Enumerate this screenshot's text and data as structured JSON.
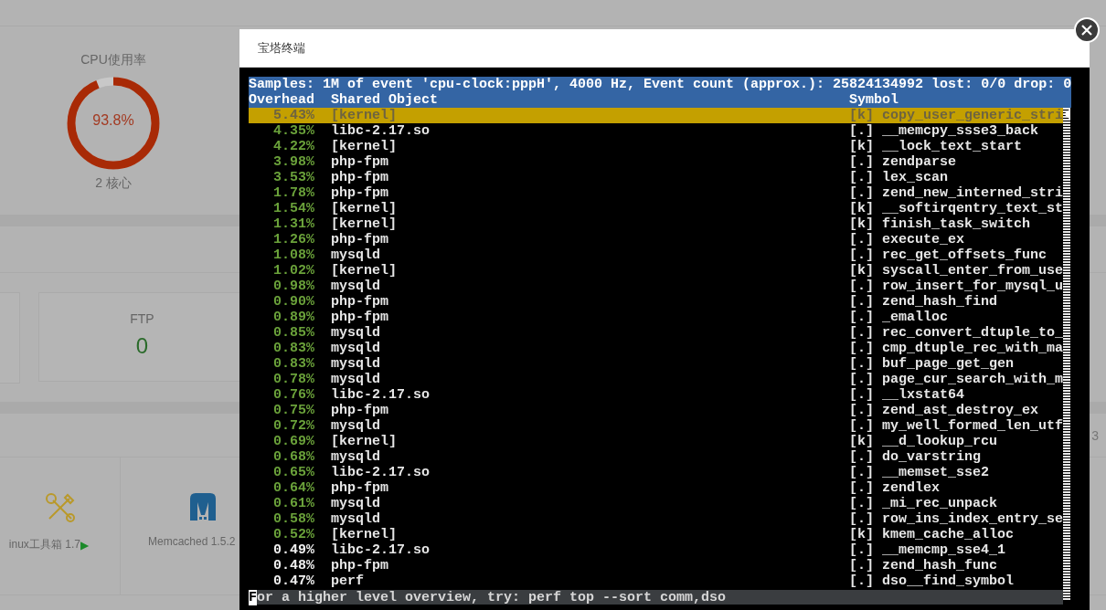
{
  "dashboard": {
    "cpu": {
      "title": "CPU使用率",
      "value": "93.8%",
      "level": 0.938,
      "cores": "2 核心"
    },
    "stat_cards": [
      {
        "label": "FTP",
        "value": "0"
      }
    ],
    "section_fragment": "3",
    "software": [
      {
        "kind": "toolbox",
        "label": "inux工具箱 1.7",
        "marker": "▶"
      },
      {
        "kind": "memcached",
        "label": "Memcached 1.5.2"
      }
    ]
  },
  "modal": {
    "title": "宝塔终端",
    "terminal": {
      "summary": "Samples: 1M of event 'cpu-clock:pppH', 4000 Hz, Event count (approx.): 25824134992 lost: 0/0 drop: 0",
      "columns": [
        "Overhead",
        "Shared Object",
        "Symbol"
      ],
      "rows": [
        {
          "overhead": "5.43%",
          "object": "[kernel]",
          "symbol": "[k] copy_user_generic_stri",
          "hot": true,
          "selected": true
        },
        {
          "overhead": "4.35%",
          "object": "libc-2.17.so",
          "symbol": "[.] __memcpy_ssse3_back",
          "hot": true,
          "selected": false
        },
        {
          "overhead": "4.22%",
          "object": "[kernel]",
          "symbol": "[k] __lock_text_start",
          "hot": true,
          "selected": false
        },
        {
          "overhead": "3.98%",
          "object": "php-fpm",
          "symbol": "[.] zendparse",
          "hot": true,
          "selected": false
        },
        {
          "overhead": "3.53%",
          "object": "php-fpm",
          "symbol": "[.] lex_scan",
          "hot": true,
          "selected": false
        },
        {
          "overhead": "1.78%",
          "object": "php-fpm",
          "symbol": "[.] zend_new_interned_stri",
          "hot": true,
          "selected": false
        },
        {
          "overhead": "1.54%",
          "object": "[kernel]",
          "symbol": "[k] __softirqentry_text_st",
          "hot": true,
          "selected": false
        },
        {
          "overhead": "1.31%",
          "object": "[kernel]",
          "symbol": "[k] finish_task_switch",
          "hot": true,
          "selected": false
        },
        {
          "overhead": "1.26%",
          "object": "php-fpm",
          "symbol": "[.] execute_ex",
          "hot": true,
          "selected": false
        },
        {
          "overhead": "1.08%",
          "object": "mysqld",
          "symbol": "[.] rec_get_offsets_func",
          "hot": true,
          "selected": false
        },
        {
          "overhead": "1.02%",
          "object": "[kernel]",
          "symbol": "[k] syscall_enter_from_use",
          "hot": true,
          "selected": false
        },
        {
          "overhead": "0.98%",
          "object": "mysqld",
          "symbol": "[.] row_insert_for_mysql_u",
          "hot": true,
          "selected": false
        },
        {
          "overhead": "0.90%",
          "object": "php-fpm",
          "symbol": "[.] zend_hash_find",
          "hot": true,
          "selected": false
        },
        {
          "overhead": "0.89%",
          "object": "php-fpm",
          "symbol": "[.] _emalloc",
          "hot": true,
          "selected": false
        },
        {
          "overhead": "0.85%",
          "object": "mysqld",
          "symbol": "[.] rec_convert_dtuple_to_",
          "hot": true,
          "selected": false
        },
        {
          "overhead": "0.83%",
          "object": "mysqld",
          "symbol": "[.] cmp_dtuple_rec_with_ma",
          "hot": true,
          "selected": false
        },
        {
          "overhead": "0.83%",
          "object": "mysqld",
          "symbol": "[.] buf_page_get_gen",
          "hot": true,
          "selected": false
        },
        {
          "overhead": "0.78%",
          "object": "mysqld",
          "symbol": "[.] page_cur_search_with_m",
          "hot": true,
          "selected": false
        },
        {
          "overhead": "0.76%",
          "object": "libc-2.17.so",
          "symbol": "[.] __lxstat64",
          "hot": true,
          "selected": false
        },
        {
          "overhead": "0.75%",
          "object": "php-fpm",
          "symbol": "[.] zend_ast_destroy_ex",
          "hot": true,
          "selected": false
        },
        {
          "overhead": "0.72%",
          "object": "mysqld",
          "symbol": "[.] my_well_formed_len_utf",
          "hot": true,
          "selected": false
        },
        {
          "overhead": "0.69%",
          "object": "[kernel]",
          "symbol": "[k] __d_lookup_rcu",
          "hot": true,
          "selected": false
        },
        {
          "overhead": "0.68%",
          "object": "mysqld",
          "symbol": "[.] do_varstring",
          "hot": true,
          "selected": false
        },
        {
          "overhead": "0.65%",
          "object": "libc-2.17.so",
          "symbol": "[.] __memset_sse2",
          "hot": true,
          "selected": false
        },
        {
          "overhead": "0.64%",
          "object": "php-fpm",
          "symbol": "[.] zendlex",
          "hot": true,
          "selected": false
        },
        {
          "overhead": "0.61%",
          "object": "mysqld",
          "symbol": "[.] _mi_rec_unpack",
          "hot": true,
          "selected": false
        },
        {
          "overhead": "0.58%",
          "object": "mysqld",
          "symbol": "[.] row_ins_index_entry_se",
          "hot": true,
          "selected": false
        },
        {
          "overhead": "0.52%",
          "object": "[kernel]",
          "symbol": "[k] kmem_cache_alloc",
          "hot": true,
          "selected": false
        },
        {
          "overhead": "0.49%",
          "object": "libc-2.17.so",
          "symbol": "[.] __memcmp_sse4_1",
          "hot": false,
          "selected": false
        },
        {
          "overhead": "0.48%",
          "object": "php-fpm",
          "symbol": "[.] zend_hash_func",
          "hot": false,
          "selected": false
        },
        {
          "overhead": "0.47%",
          "object": "perf",
          "symbol": "[.] dso__find_symbol",
          "hot": false,
          "selected": false
        }
      ],
      "status": "For a higher level overview, try: perf top --sort comm,dso"
    }
  }
}
